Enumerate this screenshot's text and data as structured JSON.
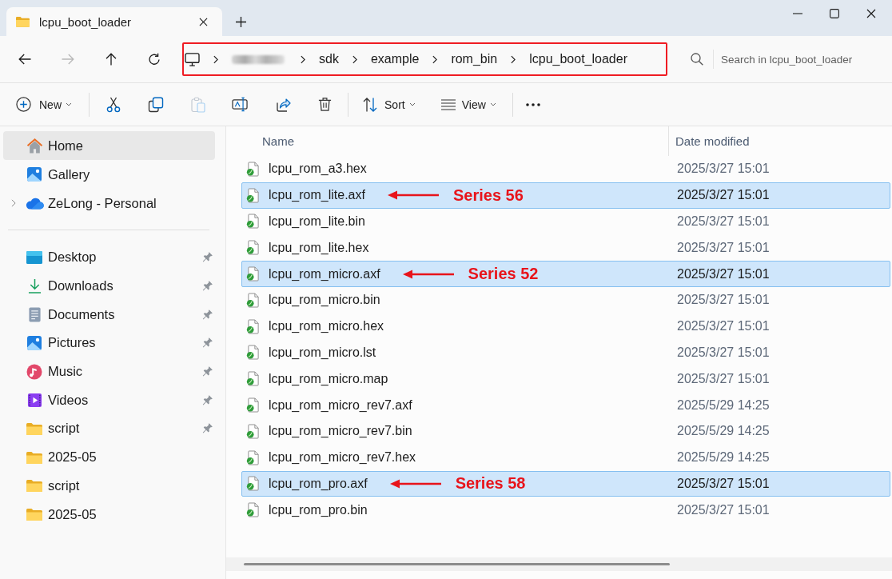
{
  "tabs": [
    {
      "title": "lcpu_boot_loader",
      "selected": true
    }
  ],
  "navigation": [
    {
      "kind": "back",
      "disabled": false
    },
    {
      "kind": "forward",
      "disabled": true
    },
    {
      "kind": "up",
      "disabled": false
    },
    {
      "kind": "refresh",
      "disabled": false
    }
  ],
  "address_bar": {
    "annotated": true,
    "crumbs": [
      {
        "kind": "computer"
      },
      {
        "kind": "redacted"
      },
      {
        "kind": "folder",
        "label": "sdk"
      },
      {
        "kind": "folder",
        "label": "example"
      },
      {
        "kind": "folder",
        "label": "rom_bin"
      },
      {
        "kind": "folder",
        "label": "lcpu_boot_loader"
      }
    ]
  },
  "search": {
    "placeholder": "Search in lcpu_boot_loader"
  },
  "toolbar": [
    {
      "kind": "new",
      "label": "New",
      "dropdown": true,
      "disabled": false
    },
    {
      "kind": "separator"
    },
    {
      "kind": "cut",
      "disabled": false
    },
    {
      "kind": "copy",
      "disabled": false
    },
    {
      "kind": "paste",
      "disabled": true
    },
    {
      "kind": "rename",
      "disabled": false
    },
    {
      "kind": "share",
      "disabled": false
    },
    {
      "kind": "delete",
      "disabled": false
    },
    {
      "kind": "separator"
    },
    {
      "kind": "sort",
      "label": "Sort",
      "dropdown": true,
      "disabled": false
    },
    {
      "kind": "view",
      "label": "View",
      "dropdown": true,
      "disabled": false
    },
    {
      "kind": "separator"
    },
    {
      "kind": "more",
      "disabled": false
    }
  ],
  "sidebar": {
    "groups": [
      {
        "items": [
          {
            "kind": "home",
            "label": "Home",
            "selected": true,
            "expandable": false,
            "pinned": false
          },
          {
            "kind": "gallery",
            "label": "Gallery",
            "selected": false,
            "expandable": false,
            "pinned": false
          },
          {
            "kind": "cloud",
            "label": "ZeLong - Personal",
            "selected": false,
            "expandable": true,
            "pinned": false
          }
        ]
      },
      {
        "items": [
          {
            "kind": "desktop",
            "label": "Desktop",
            "selected": false,
            "expandable": false,
            "pinned": true
          },
          {
            "kind": "downloads",
            "label": "Downloads",
            "selected": false,
            "expandable": false,
            "pinned": true
          },
          {
            "kind": "documents",
            "label": "Documents",
            "selected": false,
            "expandable": false,
            "pinned": true
          },
          {
            "kind": "pictures",
            "label": "Pictures",
            "selected": false,
            "expandable": false,
            "pinned": true
          },
          {
            "kind": "music",
            "label": "Music",
            "selected": false,
            "expandable": false,
            "pinned": true
          },
          {
            "kind": "videos",
            "label": "Videos",
            "selected": false,
            "expandable": false,
            "pinned": true
          },
          {
            "kind": "folder",
            "label": "script",
            "selected": false,
            "expandable": false,
            "pinned": true
          },
          {
            "kind": "folder",
            "label": "2025-05",
            "selected": false,
            "expandable": false,
            "pinned": false
          },
          {
            "kind": "folder",
            "label": "script",
            "selected": false,
            "expandable": false,
            "pinned": false
          },
          {
            "kind": "folder",
            "label": "2025-05",
            "selected": false,
            "expandable": false,
            "pinned": false
          }
        ]
      }
    ]
  },
  "file_list": {
    "columns": [
      {
        "label": "Name"
      },
      {
        "label": "Date modified"
      }
    ],
    "rows": [
      {
        "name": "lcpu_rom_a3.hex",
        "date_modified": "2025/3/27 15:01",
        "selected": false
      },
      {
        "name": "lcpu_rom_lite.axf",
        "date_modified": "2025/3/27 15:01",
        "selected": true,
        "annotation": "Series 56"
      },
      {
        "name": "lcpu_rom_lite.bin",
        "date_modified": "2025/3/27 15:01",
        "selected": false
      },
      {
        "name": "lcpu_rom_lite.hex",
        "date_modified": "2025/3/27 15:01",
        "selected": false
      },
      {
        "name": "lcpu_rom_micro.axf",
        "date_modified": "2025/3/27 15:01",
        "selected": true,
        "annotation": "Series 52"
      },
      {
        "name": "lcpu_rom_micro.bin",
        "date_modified": "2025/3/27 15:01",
        "selected": false
      },
      {
        "name": "lcpu_rom_micro.hex",
        "date_modified": "2025/3/27 15:01",
        "selected": false
      },
      {
        "name": "lcpu_rom_micro.lst",
        "date_modified": "2025/3/27 15:01",
        "selected": false
      },
      {
        "name": "lcpu_rom_micro.map",
        "date_modified": "2025/3/27 15:01",
        "selected": false
      },
      {
        "name": "lcpu_rom_micro_rev7.axf",
        "date_modified": "2025/5/29 14:25",
        "selected": false
      },
      {
        "name": "lcpu_rom_micro_rev7.bin",
        "date_modified": "2025/5/29 14:25",
        "selected": false
      },
      {
        "name": "lcpu_rom_micro_rev7.hex",
        "date_modified": "2025/5/29 14:25",
        "selected": false
      },
      {
        "name": "lcpu_rom_pro.axf",
        "date_modified": "2025/3/27 15:01",
        "selected": true,
        "annotation": "Series 58"
      },
      {
        "name": "lcpu_rom_pro.bin",
        "date_modified": "2025/3/27 15:01",
        "selected": false
      }
    ]
  }
}
